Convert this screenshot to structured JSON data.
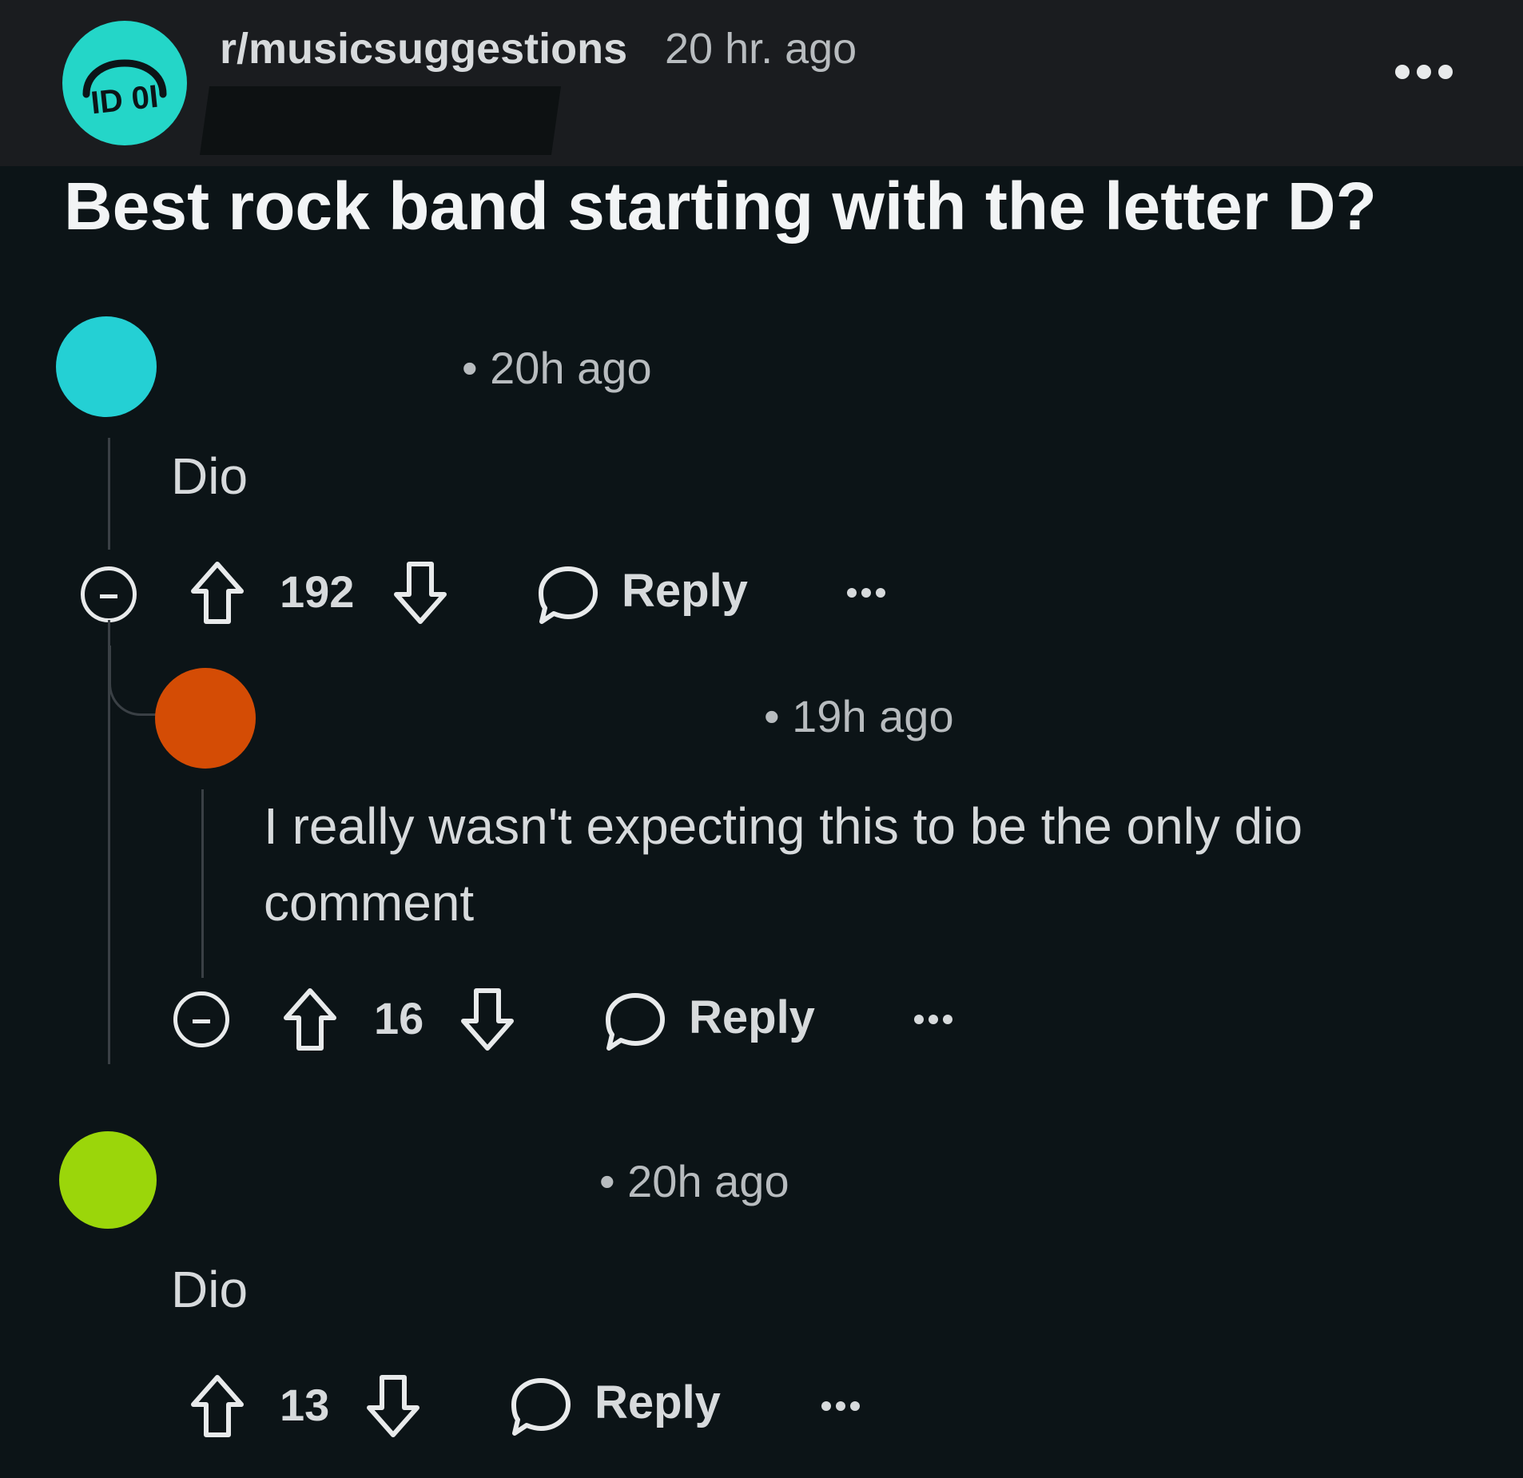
{
  "post": {
    "subreddit": "r/musicsuggestions",
    "time": "20 hr. ago",
    "title": "Best rock band starting with the letter D?",
    "icon": "headphones-icon",
    "accent": "#24d6c8"
  },
  "comments": [
    {
      "avatar_color": "#24d0d4",
      "time": "• 20h ago",
      "body": "Dio",
      "votes": "192",
      "reply_label": "Reply"
    },
    {
      "avatar_color": "#d44c05",
      "time": "• 19h ago",
      "body_line1": "I really wasn't expecting this to be the only dio",
      "body_line2": "comment",
      "votes": "16",
      "reply_label": "Reply"
    },
    {
      "avatar_color": "#9bd60a",
      "time": "• 20h ago",
      "body": "Dio",
      "votes": "13",
      "reply_label": "Reply"
    }
  ]
}
